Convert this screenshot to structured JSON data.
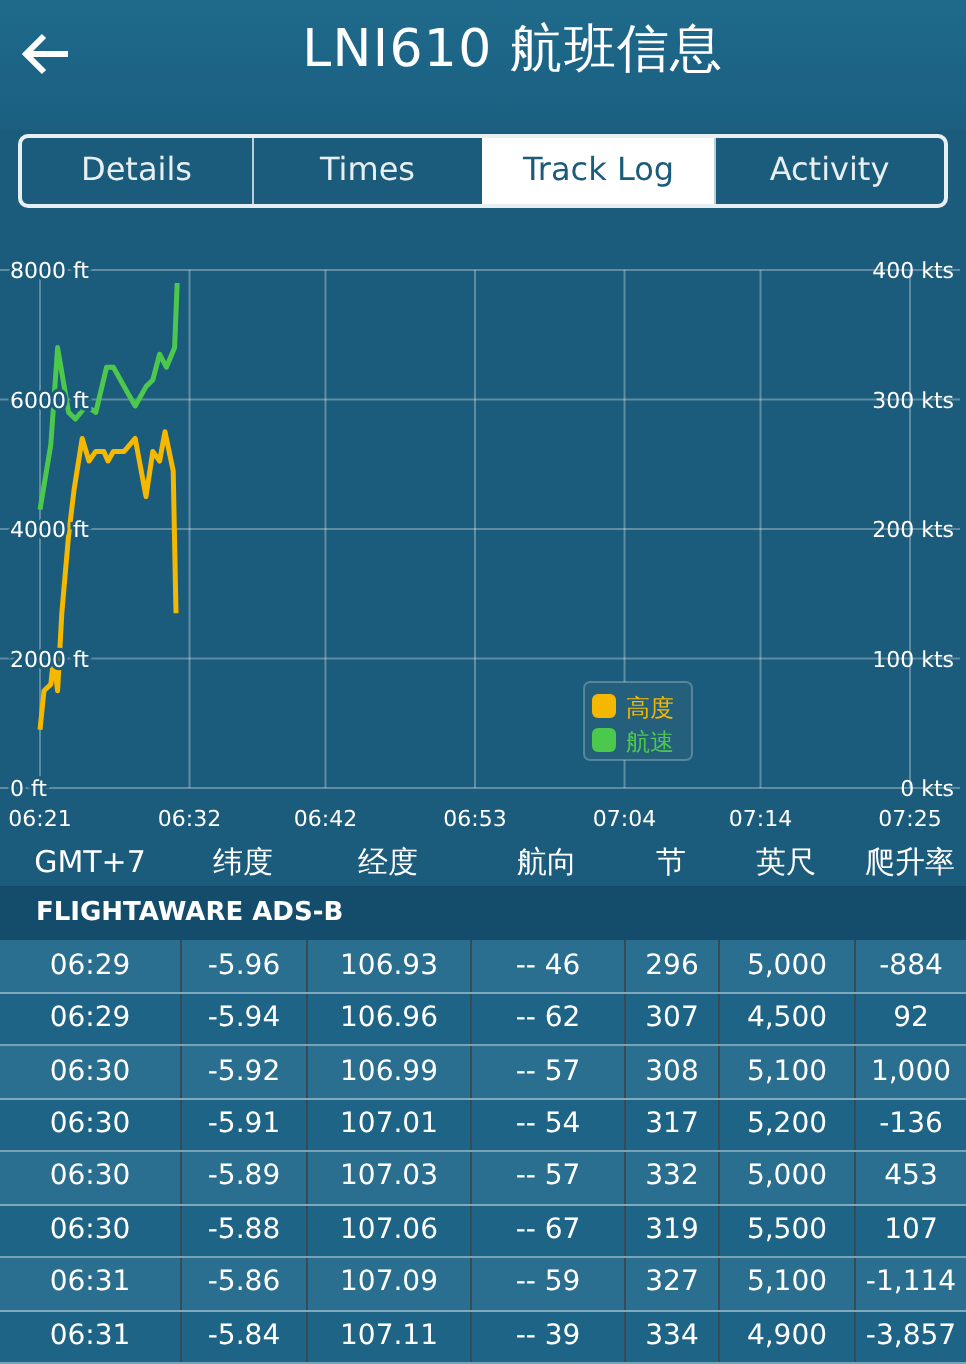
{
  "header": {
    "title": "LNI610 航班信息"
  },
  "tabs": [
    {
      "label": "Details",
      "selected": false
    },
    {
      "label": "Times",
      "selected": false
    },
    {
      "label": "Track Log",
      "selected": true
    },
    {
      "label": "Activity",
      "selected": false
    }
  ],
  "chart": {
    "chart_data": {
      "type": "line",
      "grid": true,
      "legend": true,
      "xlim": [
        381,
        445
      ],
      "ylim": [
        0,
        8000
      ],
      "y2lim": [
        0,
        400
      ],
      "y2ticks": [
        {
          "value": 0,
          "label": "0 kts"
        },
        {
          "value": 100,
          "label": "100 kts"
        },
        {
          "value": 200,
          "label": "200 kts"
        },
        {
          "value": 300,
          "label": "300 kts"
        },
        {
          "value": 400,
          "label": "400 kts"
        }
      ],
      "xticks": [
        {
          "value": 381,
          "label": "06:21"
        },
        {
          "value": 392,
          "label": "06:32"
        },
        {
          "value": 402,
          "label": "06:42"
        },
        {
          "value": 413,
          "label": "06:53"
        },
        {
          "value": 424,
          "label": "07:04"
        },
        {
          "value": 434,
          "label": "07:14"
        },
        {
          "value": 445,
          "label": "07:25"
        }
      ],
      "yticks": [
        {
          "value": 0,
          "label": "0 ft"
        },
        {
          "value": 2000,
          "label": "2000 ft"
        },
        {
          "value": 4000,
          "label": "4000 ft"
        },
        {
          "value": 6000,
          "label": "6000 ft"
        },
        {
          "value": 8000,
          "label": "8000 ft"
        }
      ],
      "series": [
        {
          "name": "高度",
          "color": "#f5b800",
          "x": [
            381,
            381.3,
            381.8,
            382,
            382.3,
            382.6,
            383.1,
            383.5,
            384.1,
            384.6,
            385.1,
            385.7,
            386,
            386.4,
            387.2,
            388,
            388.8,
            389.3,
            389.8,
            390.2,
            390.8,
            391
          ],
          "values": [
            900,
            1500,
            1600,
            2000,
            1500,
            2700,
            3900,
            4600,
            5400,
            5050,
            5200,
            5200,
            5050,
            5200,
            5200,
            5400,
            4500,
            5200,
            5050,
            5500,
            4900,
            2700
          ]
        },
        {
          "name": "航速",
          "color": "#4cc94c",
          "axis": "y2",
          "x": [
            381,
            381.8,
            382.3,
            383.1,
            383.6,
            384.4,
            385.1,
            385.9,
            386.4,
            387.2,
            388,
            388.8,
            389.3,
            389.8,
            390.3,
            390.9,
            391.1
          ],
          "values": [
            215,
            265,
            340,
            290,
            285,
            295,
            290,
            325,
            325,
            310,
            295,
            310,
            315,
            335,
            325,
            340,
            390
          ]
        }
      ]
    }
  },
  "table": {
    "columns": [
      "GMT+7",
      "纬度",
      "经度",
      "航向",
      "节",
      "英尺",
      "爬升率"
    ],
    "section": "FLIGHTAWARE ADS-B",
    "rows": [
      [
        "06:29",
        "-5.96",
        "106.93",
        "-- 46",
        "296",
        "5,000",
        "-884"
      ],
      [
        "06:29",
        "-5.94",
        "106.96",
        "-- 62",
        "307",
        "4,500",
        "92"
      ],
      [
        "06:30",
        "-5.92",
        "106.99",
        "-- 57",
        "308",
        "5,100",
        "1,000"
      ],
      [
        "06:30",
        "-5.91",
        "107.01",
        "-- 54",
        "317",
        "5,200",
        "-136"
      ],
      [
        "06:30",
        "-5.89",
        "107.03",
        "-- 57",
        "332",
        "5,000",
        "453"
      ],
      [
        "06:30",
        "-5.88",
        "107.06",
        "-- 67",
        "319",
        "5,500",
        "107"
      ],
      [
        "06:31",
        "-5.86",
        "107.09",
        "-- 59",
        "327",
        "5,100",
        "-1,114"
      ],
      [
        "06:31",
        "-5.84",
        "107.11",
        "-- 39",
        "334",
        "4,900",
        "-3,857"
      ]
    ]
  }
}
